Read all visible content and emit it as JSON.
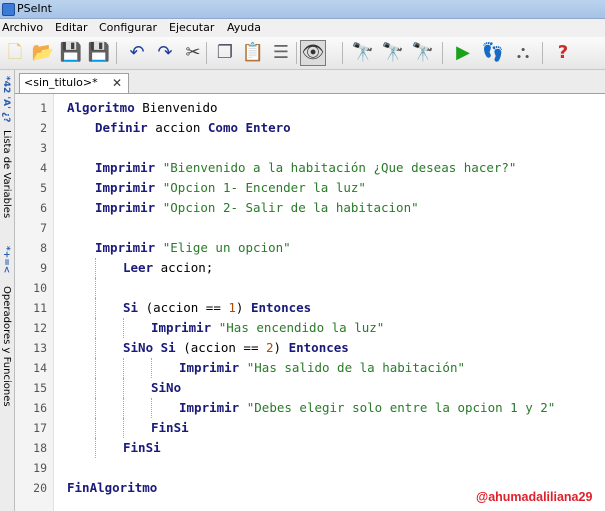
{
  "window": {
    "title": "PSeInt"
  },
  "menu": [
    "Archivo",
    "Editar",
    "Configurar",
    "Ejecutar",
    "Ayuda"
  ],
  "toolbar": [
    {
      "name": "new-file-icon",
      "glyph": "🗋",
      "color": "#e9c46a"
    },
    {
      "name": "open-folder-icon",
      "glyph": "📂",
      "color": "#d9a23a"
    },
    {
      "name": "save-icon",
      "glyph": "💾",
      "color": "#7a3a2a"
    },
    {
      "name": "save-as-icon",
      "glyph": "💾",
      "color": "#a02a2a"
    },
    {
      "name": "undo-icon",
      "glyph": "↶",
      "color": "#1f3f9a"
    },
    {
      "name": "redo-icon",
      "glyph": "↷",
      "color": "#1f3f9a"
    },
    {
      "name": "cut-icon",
      "glyph": "✂",
      "color": "#444"
    },
    {
      "name": "copy-icon",
      "glyph": "❐",
      "color": "#556"
    },
    {
      "name": "paste-icon",
      "glyph": "📋",
      "color": "#8a5a20"
    },
    {
      "name": "indent-icon",
      "glyph": "☰",
      "color": "#666"
    },
    {
      "name": "find-replace-icon",
      "glyph": "👁",
      "color": "#333"
    },
    {
      "name": "find-icon",
      "glyph": "🔭",
      "color": "#222"
    },
    {
      "name": "find-previous-icon",
      "glyph": "🔭",
      "color": "#2a4a9a"
    },
    {
      "name": "find-next-icon",
      "glyph": "🔭",
      "color": "#2a4a9a"
    },
    {
      "name": "run-icon",
      "glyph": "▶",
      "color": "#1aa31a"
    },
    {
      "name": "step-by-step-icon",
      "glyph": "👣",
      "color": "#c86a3a"
    },
    {
      "name": "flowchart-icon",
      "glyph": "⛬",
      "color": "#555"
    },
    {
      "name": "help-icon",
      "glyph": "?",
      "color": "#d02a2a"
    }
  ],
  "side_panel": {
    "variables_label": "Lista de Variables",
    "operators_label": "Operadores y Funciones",
    "variables_icon": "*42 'A' ¿?",
    "operators_icon": "*+=<"
  },
  "tab": {
    "label": "<sin_titulo>*",
    "close": "✕"
  },
  "code": [
    {
      "n": "1",
      "indent": 0,
      "tokens": [
        [
          "kw",
          "Algoritmo"
        ],
        [
          "txt",
          " Bienvenido"
        ]
      ]
    },
    {
      "n": "2",
      "indent": 1,
      "tokens": [
        [
          "kw",
          "Definir"
        ],
        [
          "txt",
          " accion "
        ],
        [
          "kw",
          "Como Entero"
        ]
      ]
    },
    {
      "n": "3",
      "indent": 1,
      "tokens": []
    },
    {
      "n": "4",
      "indent": 1,
      "tokens": [
        [
          "kw",
          "Imprimir"
        ],
        [
          "txt",
          " "
        ],
        [
          "str",
          "\"Bienvenido a la habitación ¿Que deseas hacer?\""
        ]
      ]
    },
    {
      "n": "5",
      "indent": 1,
      "tokens": [
        [
          "kw",
          "Imprimir"
        ],
        [
          "txt",
          " "
        ],
        [
          "str",
          "\"Opcion 1- Encender la luz\""
        ]
      ]
    },
    {
      "n": "6",
      "indent": 1,
      "tokens": [
        [
          "kw",
          "Imprimir"
        ],
        [
          "txt",
          " "
        ],
        [
          "str",
          "\"Opcion 2- Salir de la habitacion\""
        ]
      ]
    },
    {
      "n": "7",
      "indent": 1,
      "tokens": []
    },
    {
      "n": "8",
      "indent": 1,
      "tokens": [
        [
          "kw",
          "Imprimir"
        ],
        [
          "txt",
          " "
        ],
        [
          "str",
          "\"Elige un opcion\""
        ]
      ]
    },
    {
      "n": "9",
      "indent": 2,
      "tokens": [
        [
          "kw",
          "Leer"
        ],
        [
          "txt",
          " accion;"
        ]
      ]
    },
    {
      "n": "10",
      "indent": 2,
      "tokens": []
    },
    {
      "n": "11",
      "indent": 2,
      "tokens": [
        [
          "kw",
          "Si"
        ],
        [
          "txt",
          " (accion == "
        ],
        [
          "num",
          "1"
        ],
        [
          "txt",
          ") "
        ],
        [
          "kw",
          "Entonces"
        ]
      ]
    },
    {
      "n": "12",
      "indent": 3,
      "tokens": [
        [
          "kw",
          "Imprimir"
        ],
        [
          "txt",
          " "
        ],
        [
          "str",
          "\"Has encendido la luz\""
        ]
      ]
    },
    {
      "n": "13",
      "indent": 2,
      "tokens": [
        [
          "kw",
          "SiNo Si"
        ],
        [
          "txt",
          " (accion == "
        ],
        [
          "num",
          "2"
        ],
        [
          "txt",
          ") "
        ],
        [
          "kw",
          "Entonces"
        ]
      ]
    },
    {
      "n": "14",
      "indent": 4,
      "tokens": [
        [
          "kw",
          "Imprimir"
        ],
        [
          "txt",
          " "
        ],
        [
          "str",
          "\"Has salido de la habitación\""
        ]
      ]
    },
    {
      "n": "15",
      "indent": 3,
      "tokens": [
        [
          "kw",
          "SiNo"
        ]
      ]
    },
    {
      "n": "16",
      "indent": 4,
      "tokens": [
        [
          "kw",
          "Imprimir"
        ],
        [
          "txt",
          " "
        ],
        [
          "str",
          "\"Debes elegir solo entre la opcion 1 y 2\""
        ]
      ]
    },
    {
      "n": "17",
      "indent": 3,
      "tokens": [
        [
          "kw",
          "FinSi"
        ]
      ]
    },
    {
      "n": "18",
      "indent": 2,
      "tokens": [
        [
          "kw",
          "FinSi"
        ]
      ]
    },
    {
      "n": "19",
      "indent": 0,
      "tokens": []
    },
    {
      "n": "20",
      "indent": 0,
      "tokens": [
        [
          "kw",
          "FinAlgoritmo"
        ]
      ]
    }
  ],
  "watermark": "@ahumadaliliana29",
  "colors": {
    "keyword": "#1a1a7a",
    "string": "#2a7a2a",
    "number": "#b04a00",
    "watermark": "#e0202a"
  }
}
